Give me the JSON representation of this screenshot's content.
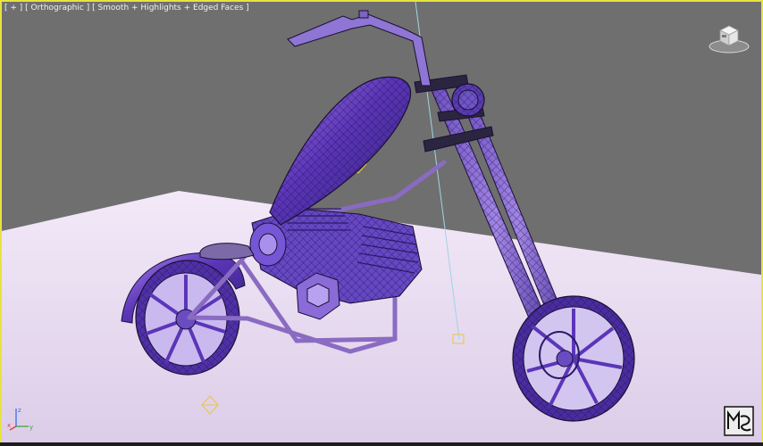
{
  "viewport": {
    "label": "[ + ] [ Orthographic ] [ Smooth + Highlights + Edged Faces ]",
    "border_color": "#e8e33c",
    "background_color": "#6f6f6f",
    "ground_color": "#efe3f4"
  },
  "model": {
    "primary_color": "#5b35b8",
    "highlight_color": "#a784ee",
    "frame_color": "#8a6bc2",
    "wire_color": "#1a1036"
  },
  "viewcube": {
    "icon": "viewcube-icon"
  },
  "axis_tripod": {
    "x_label": "x",
    "y_label": "y",
    "z_label": "z"
  },
  "logo": {
    "icon": "max-logo-icon"
  },
  "status": {
    "text": ""
  }
}
